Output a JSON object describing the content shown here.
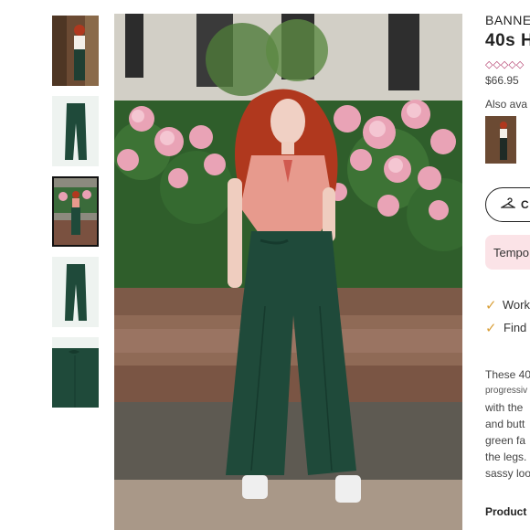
{
  "product": {
    "brand": "BANNE",
    "title": "40s H",
    "rating_icons": "◇◇◇◇◇",
    "price": "$66.95",
    "also_available": "Also ava",
    "size_button": "C",
    "notice": "Tempo",
    "bullets": [
      "Work",
      "Find"
    ],
    "description": [
      "These 40",
      "progressiv",
      "with the",
      "and butt",
      "green fa",
      "the legs.",
      "sassy loo"
    ],
    "details_label": "Product"
  },
  "icons": {
    "size_icon": "hanger-icon",
    "check_icon": "check-icon",
    "rating": "diamond-outline-icon"
  },
  "colors": {
    "accent": "#b23a6a",
    "check": "#d9a03a",
    "notice_bg": "#fbe3e7",
    "pants": "#1f4a3a",
    "hair": "#b0381e"
  }
}
